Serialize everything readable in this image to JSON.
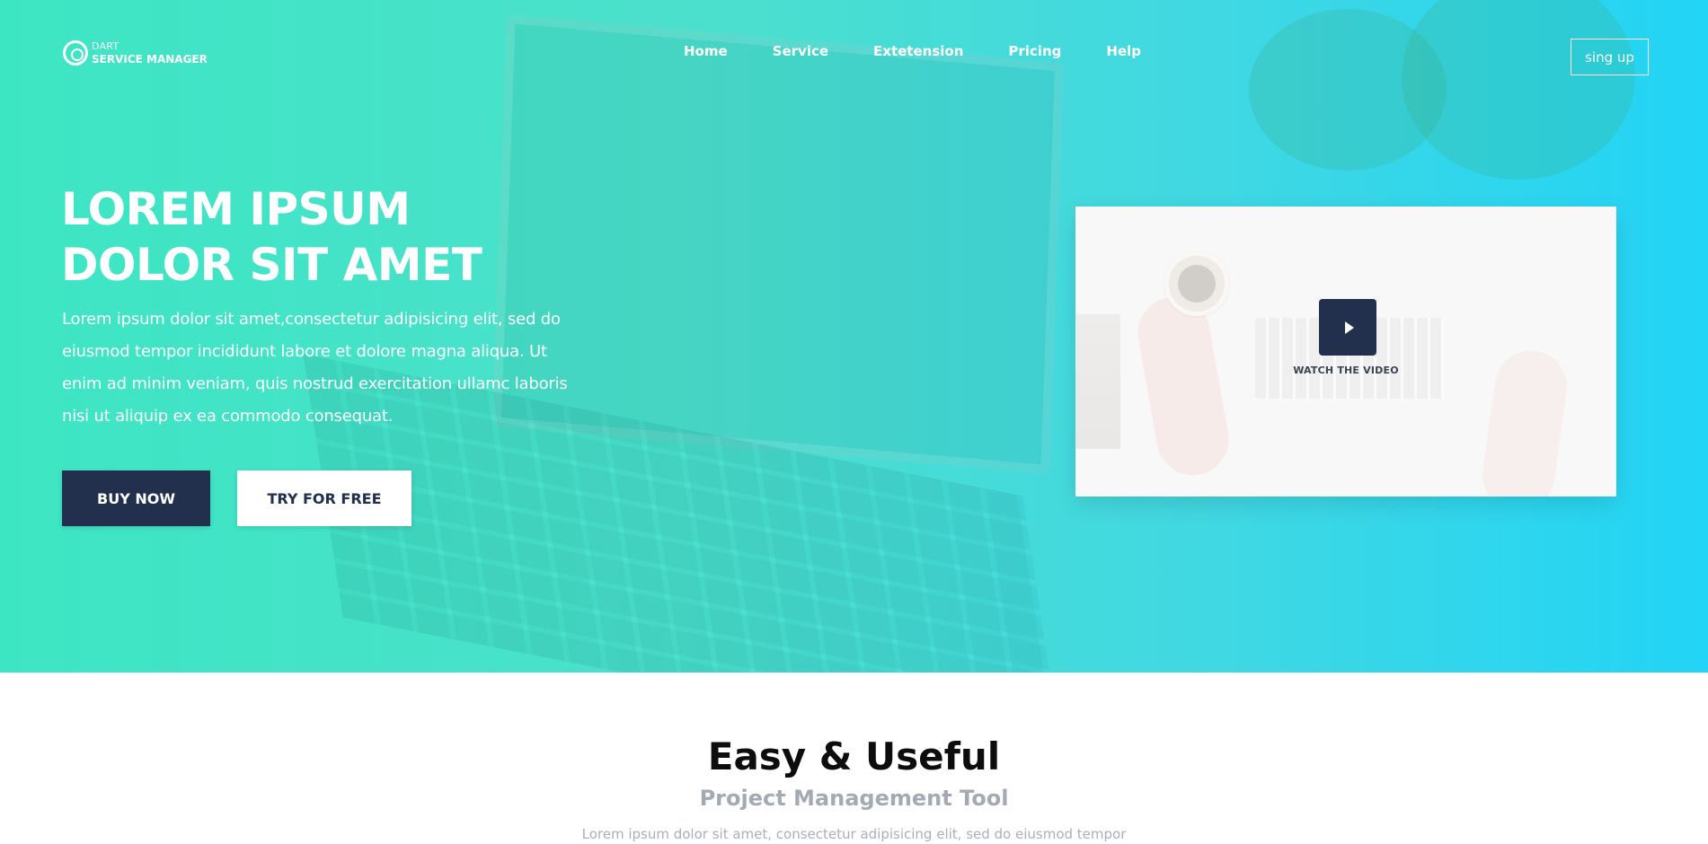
{
  "brand": {
    "line1": "DART",
    "line2": "SERVICE MANAGER"
  },
  "nav": {
    "home": "Home",
    "service": "Service",
    "extension": "Extetension",
    "pricing": "Pricing",
    "help": "Help"
  },
  "signup_label": "sing up",
  "hero": {
    "title_line1": "LOREM IPSUM",
    "title_line2": "DOLOR SIT AMET",
    "lead": "Lorem ipsum dolor sit amet,consectetur adipisicing elit, sed do eiusmod tempor incididunt labore et dolore magna aliqua. Ut enim ad minim veniam, quis nostrud exercitation ullamc laboris nisi ut aliquip ex ea commodo consequat.",
    "buy_label": "BUY NOW",
    "try_label": "TRY FOR FREE",
    "video_label": "WATCH THE VIDEO"
  },
  "features": {
    "title": "Easy & Useful",
    "subtitle": "Project Management Tool",
    "text": "Lorem ipsum dolor sit amet, consectetur adipisicing elit, sed do eiusmod tempor"
  },
  "colors": {
    "gradient_start": "#3de6c3",
    "gradient_end": "#22d4f5",
    "navy": "#22304d"
  },
  "icons": {
    "logo": "target-logo-icon",
    "play": "play-icon"
  }
}
